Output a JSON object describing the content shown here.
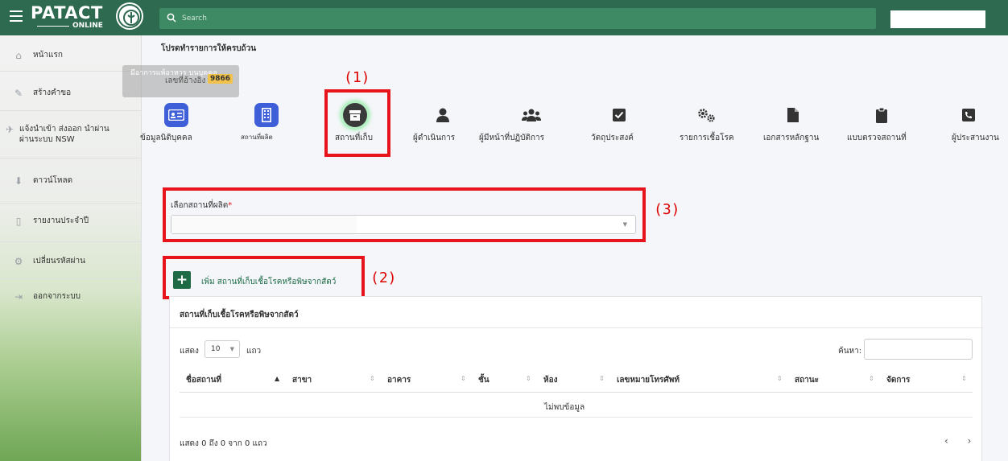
{
  "brand": {
    "name": "PATACT",
    "sub": "ONLINE"
  },
  "search": {
    "placeholder": "Search"
  },
  "sidebar": {
    "items": [
      {
        "icon": "home-icon",
        "label": "หน้าแรก"
      },
      {
        "icon": "pencil-icon",
        "label": "สร้างคำขอ"
      },
      {
        "icon": "plane-icon",
        "label": "แจ้งนำเข้า ส่งออก นำผ่าน ผ่านระบบ NSW"
      },
      {
        "icon": "download-icon",
        "label": "ดาวน์โหลด"
      },
      {
        "icon": "file-icon",
        "label": "รายงานประจำปี"
      },
      {
        "icon": "cogs-icon",
        "label": "เปลี่ยนรหัสผ่าน"
      },
      {
        "icon": "logout-icon",
        "label": "ออกจากระบบ"
      }
    ],
    "tooltip": "มีอาการแพ้อาหาร บนบุคคล"
  },
  "page": {
    "title": "โปรดทำรายการให้ครบถ้วน",
    "ref_label": "เลขที่อ้างอิง :",
    "ref_number": "9866"
  },
  "steps": [
    {
      "label": "ข้อมูลนิติบุคคล",
      "icon": "id-card-icon",
      "state": "done"
    },
    {
      "label": "สถานที่ผลิต",
      "icon": "building-icon",
      "state": "done"
    },
    {
      "label": "สถานที่เก็บ",
      "icon": "archive-icon",
      "state": "active"
    },
    {
      "label": "ผู้ดำเนินการ",
      "icon": "user-icon",
      "state": "todo"
    },
    {
      "label": "ผู้มีหน้าที่ปฏิบัติการ",
      "icon": "users-icon",
      "state": "todo"
    },
    {
      "label": "วัตถุประสงค์",
      "icon": "check-square-icon",
      "state": "todo"
    },
    {
      "label": "รายการเชื้อโรค",
      "icon": "cogs-icon",
      "state": "todo"
    },
    {
      "label": "เอกสารหลักฐาน",
      "icon": "file-icon",
      "state": "todo"
    },
    {
      "label": "แบบตรวจสถานที่",
      "icon": "clipboard-icon",
      "state": "todo"
    },
    {
      "label": "ผู้ประสานงาน",
      "icon": "phone-icon",
      "state": "todo"
    }
  ],
  "annotations": {
    "a1": "(1)",
    "a2": "(2)",
    "a3": "(3)"
  },
  "form": {
    "select_label": "เลือกสถานที่ผลิต",
    "required_mark": "*",
    "add_label": "เพิ่ม สถานที่เก็บเชื้อโรคหรือพิษจากสัตว์"
  },
  "table": {
    "title": "สถานที่เก็บเชื้อโรคหรือพิษจากสัตว์",
    "show_label": "แสดง",
    "page_size": "10",
    "rows_label": "แถว",
    "search_label": "ค้นหา:",
    "columns": [
      "ชื่อสถานที่",
      "สาขา",
      "อาคาร",
      "ชั้น",
      "ห้อง",
      "เลขหมายโทรศัพท์",
      "สถานะ",
      "จัดการ"
    ],
    "empty_text": "ไม่พบข้อมูล",
    "info": "แสดง 0 ถึง 0 จาก 0 แถว",
    "pager": "‹ ›"
  },
  "colors": {
    "topbar": "#2d6a4f",
    "accent_blue": "#3f5fd8",
    "annotation_red": "#e8141b",
    "badge": "#f0c14b"
  }
}
